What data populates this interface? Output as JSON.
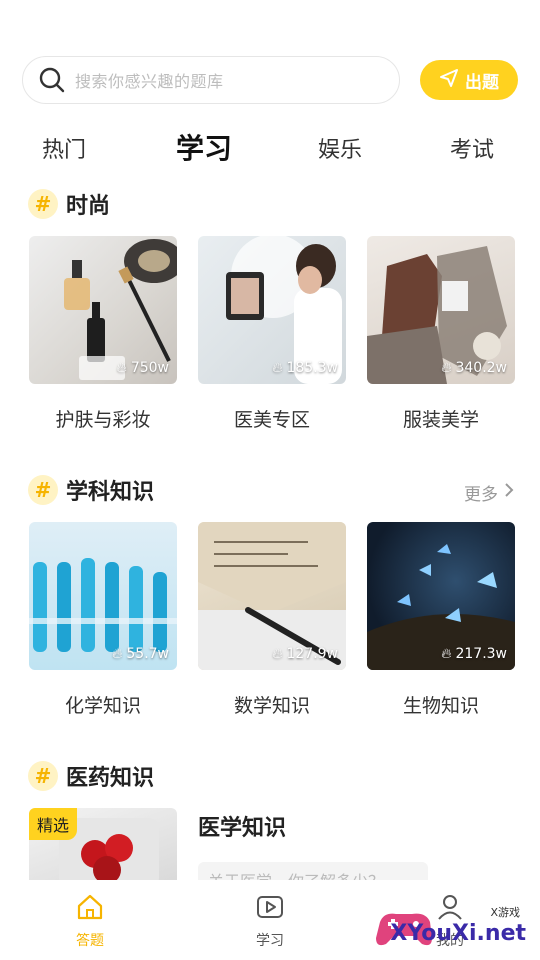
{
  "search": {
    "placeholder": "搜索你感兴趣的题库"
  },
  "ask_button": {
    "label": "出题"
  },
  "tabs": [
    {
      "label": "热门",
      "active": false
    },
    {
      "label": "学习",
      "active": true
    },
    {
      "label": "娱乐",
      "active": false
    },
    {
      "label": "考试",
      "active": false
    }
  ],
  "sections": {
    "fashion": {
      "title": "时尚",
      "items": [
        {
          "label": "护肤与彩妆",
          "count": "750w"
        },
        {
          "label": "医美专区",
          "count": "185.3w"
        },
        {
          "label": "服装美学",
          "count": "340.2w"
        }
      ]
    },
    "knowledge": {
      "title": "学科知识",
      "more": "更多",
      "items": [
        {
          "label": "化学知识",
          "count": "55.7w"
        },
        {
          "label": "数学知识",
          "count": "127.9w"
        },
        {
          "label": "生物知识",
          "count": "217.3w"
        }
      ]
    },
    "medicine": {
      "title": "医药知识",
      "featured": {
        "tag": "精选",
        "title": "医学知识",
        "desc": "关于医学，你了解多少？"
      }
    }
  },
  "bottom_nav": [
    {
      "label": "答题",
      "icon": "home-icon",
      "active": true
    },
    {
      "label": "学习",
      "icon": "play-icon",
      "active": false
    },
    {
      "label": "我的",
      "icon": "user-icon",
      "active": false
    }
  ],
  "watermark": {
    "brand": "XYouXi.net",
    "small": "X游戏"
  },
  "colors": {
    "accent": "#ffd21f",
    "accent_text": "#f6b400"
  }
}
